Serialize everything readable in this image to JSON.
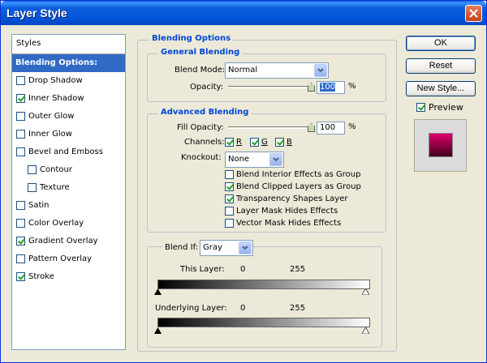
{
  "window": {
    "title": "Layer Style"
  },
  "styles_panel": {
    "header": "Styles",
    "items": [
      {
        "label": "Blending Options: Default",
        "checkbox": false,
        "checked": false,
        "selected": true,
        "indent": false
      },
      {
        "label": "Drop Shadow",
        "checkbox": true,
        "checked": false,
        "selected": false,
        "indent": false
      },
      {
        "label": "Inner Shadow",
        "checkbox": true,
        "checked": true,
        "selected": false,
        "indent": false
      },
      {
        "label": "Outer Glow",
        "checkbox": true,
        "checked": false,
        "selected": false,
        "indent": false
      },
      {
        "label": "Inner Glow",
        "checkbox": true,
        "checked": false,
        "selected": false,
        "indent": false
      },
      {
        "label": "Bevel and Emboss",
        "checkbox": true,
        "checked": false,
        "selected": false,
        "indent": false
      },
      {
        "label": "Contour",
        "checkbox": true,
        "checked": false,
        "selected": false,
        "indent": true
      },
      {
        "label": "Texture",
        "checkbox": true,
        "checked": false,
        "selected": false,
        "indent": true
      },
      {
        "label": "Satin",
        "checkbox": true,
        "checked": false,
        "selected": false,
        "indent": false
      },
      {
        "label": "Color Overlay",
        "checkbox": true,
        "checked": false,
        "selected": false,
        "indent": false
      },
      {
        "label": "Gradient Overlay",
        "checkbox": true,
        "checked": true,
        "selected": false,
        "indent": false
      },
      {
        "label": "Pattern Overlay",
        "checkbox": true,
        "checked": false,
        "selected": false,
        "indent": false
      },
      {
        "label": "Stroke",
        "checkbox": true,
        "checked": true,
        "selected": false,
        "indent": false
      }
    ]
  },
  "buttons": {
    "ok": "OK",
    "reset": "Reset",
    "new_style": "New Style...",
    "preview": "Preview",
    "preview_checked": true
  },
  "blending_options": {
    "title": "Blending Options",
    "general": {
      "title": "General Blending",
      "blend_mode_label": "Blend Mode:",
      "blend_mode_value": "Normal",
      "opacity_label": "Opacity:",
      "opacity_value": "100",
      "opacity_unit": "%",
      "opacity_level": 1.0
    },
    "advanced": {
      "title": "Advanced Blending",
      "fill_opacity_label": "Fill Opacity:",
      "fill_opacity_value": "100",
      "fill_opacity_unit": "%",
      "fill_opacity_level": 1.0,
      "channels_label": "Channels:",
      "channels": [
        {
          "label": "R",
          "checked": true
        },
        {
          "label": "G",
          "checked": true
        },
        {
          "label": "B",
          "checked": true
        }
      ],
      "knockout_label": "Knockout:",
      "knockout_value": "None",
      "options": [
        {
          "label": "Blend Interior Effects as Group",
          "checked": false
        },
        {
          "label": "Blend Clipped Layers as Group",
          "checked": true
        },
        {
          "label": "Transparency Shapes Layer",
          "checked": true
        },
        {
          "label": "Layer Mask Hides Effects",
          "checked": false
        },
        {
          "label": "Vector Mask Hides Effects",
          "checked": false
        }
      ]
    },
    "blend_if": {
      "label": "Blend If:",
      "value": "Gray",
      "this_layer_label": "This Layer:",
      "this_layer_min": "0",
      "this_layer_max": "255",
      "underlying_label": "Underlying Layer:",
      "underlying_min": "0",
      "underlying_max": "255"
    }
  },
  "colors": {
    "selection": "#316ac5",
    "group_title": "#0046d5",
    "preview_top": "#e0006c",
    "preview_bottom": "#40001c"
  }
}
